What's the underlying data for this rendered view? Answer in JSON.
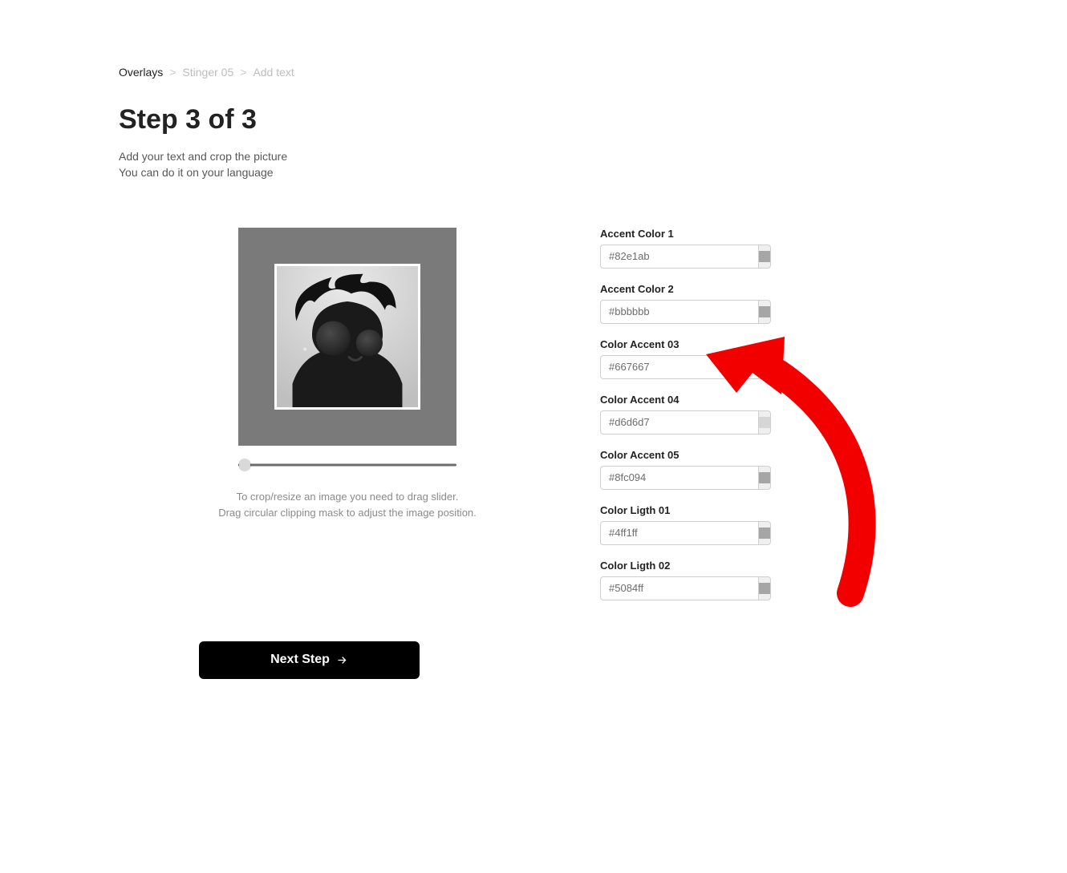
{
  "breadcrumb": {
    "items": [
      "Overlays",
      "Stinger 05",
      "Add text"
    ]
  },
  "heading": {
    "title": "Step 3 of 3",
    "subtitle_line_1": "Add your text and crop the picture",
    "subtitle_line_2": "You can do it on your language"
  },
  "cropper": {
    "helper_line_1": "To crop/resize an image you need to drag slider.",
    "helper_line_2": "Drag circular clipping mask to adjust the image position."
  },
  "next_button": {
    "label": "Next Step"
  },
  "colors": [
    {
      "label": "Accent Color 1",
      "value": "#82e1ab",
      "swatch_color": "#a6a6a6"
    },
    {
      "label": "Accent Color 2",
      "value": "#bbbbbb",
      "swatch_color": "#a6a6a6"
    },
    {
      "label": "Color Accent 03",
      "value": "#667667",
      "swatch_color": "#6b6b6b"
    },
    {
      "label": "Color Accent 04",
      "value": "#d6d6d7",
      "swatch_color": "#d6d6d7"
    },
    {
      "label": "Color Accent 05",
      "value": "#8fc094",
      "swatch_color": "#a6a6a6"
    },
    {
      "label": "Color Ligth 01",
      "value": "#4ff1ff",
      "swatch_color": "#a6a6a6"
    },
    {
      "label": "Color Ligth 02",
      "value": "#5084ff",
      "swatch_color": "#a6a6a6"
    }
  ]
}
